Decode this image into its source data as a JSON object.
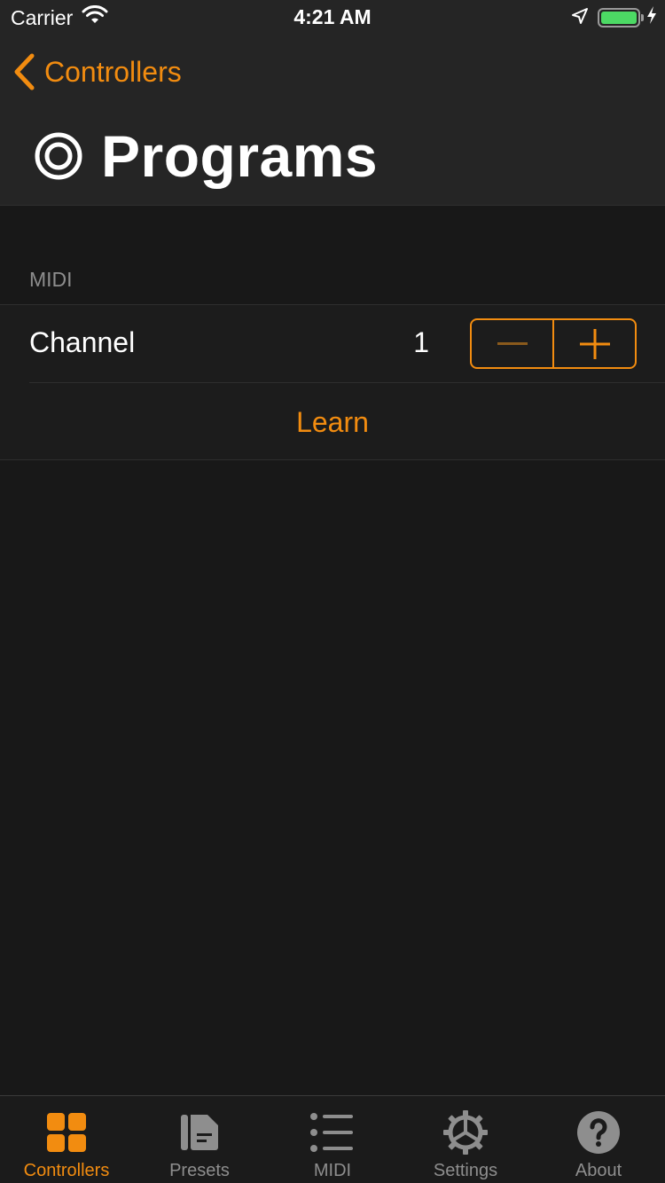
{
  "status_bar": {
    "carrier": "Carrier",
    "time": "4:21 AM",
    "battery_level": 1.0,
    "battery_color": "#4cd964"
  },
  "nav": {
    "back_label": "Controllers",
    "title": "Programs",
    "title_icon": "concentric-circles-icon"
  },
  "section": {
    "header": "MIDI",
    "channel": {
      "label": "Channel",
      "value": "1"
    },
    "learn_label": "Learn"
  },
  "tabs": [
    {
      "label": "Controllers",
      "icon": "grid-icon",
      "active": true
    },
    {
      "label": "Presets",
      "icon": "document-icon",
      "active": false
    },
    {
      "label": "MIDI",
      "icon": "list-icon",
      "active": false
    },
    {
      "label": "Settings",
      "icon": "gear-icon",
      "active": false
    },
    {
      "label": "About",
      "icon": "question-icon",
      "active": false
    }
  ],
  "colors": {
    "accent": "#f28c10",
    "background": "#181818",
    "header_bg": "#252525",
    "inactive": "#8e8e8e"
  }
}
